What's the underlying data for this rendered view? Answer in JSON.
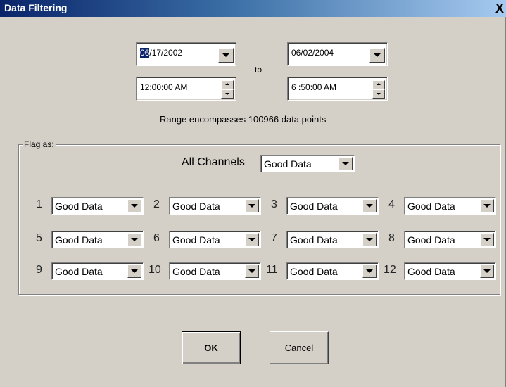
{
  "window": {
    "title": "Data Filtering",
    "close_glyph": "X"
  },
  "range": {
    "start_date_selected": "06",
    "start_date_rest": "/17/2002",
    "start_time": "12:00:00 AM",
    "to_label": "to",
    "end_date": "06/02/2004",
    "end_time": "6 :50:00 AM",
    "summary": "Range encompasses 100966 data points"
  },
  "flag": {
    "group_label": "Flag as:",
    "all_channels_label": "All Channels",
    "all_channels_value": "Good Data",
    "channels": [
      {
        "num": "1",
        "value": "Good Data"
      },
      {
        "num": "2",
        "value": "Good Data"
      },
      {
        "num": "3",
        "value": "Good Data"
      },
      {
        "num": "4",
        "value": "Good Data"
      },
      {
        "num": "5",
        "value": "Good Data"
      },
      {
        "num": "6",
        "value": "Good Data"
      },
      {
        "num": "7",
        "value": "Good Data"
      },
      {
        "num": "8",
        "value": "Good Data"
      },
      {
        "num": "9",
        "value": "Good Data"
      },
      {
        "num": "10",
        "value": "Good Data"
      },
      {
        "num": "11",
        "value": "Good Data"
      },
      {
        "num": "12",
        "value": "Good Data"
      }
    ]
  },
  "buttons": {
    "ok": "OK",
    "cancel": "Cancel"
  },
  "icons": {
    "dropdown": "chevron-down-icon",
    "spin_up": "arrow-up-icon",
    "spin_down": "arrow-down-icon",
    "close": "close-icon"
  },
  "colors": {
    "dialog_bg": "#d4d0c8",
    "titlebar_start": "#0a246a",
    "titlebar_end": "#a6caf0",
    "selection": "#0a246a"
  }
}
